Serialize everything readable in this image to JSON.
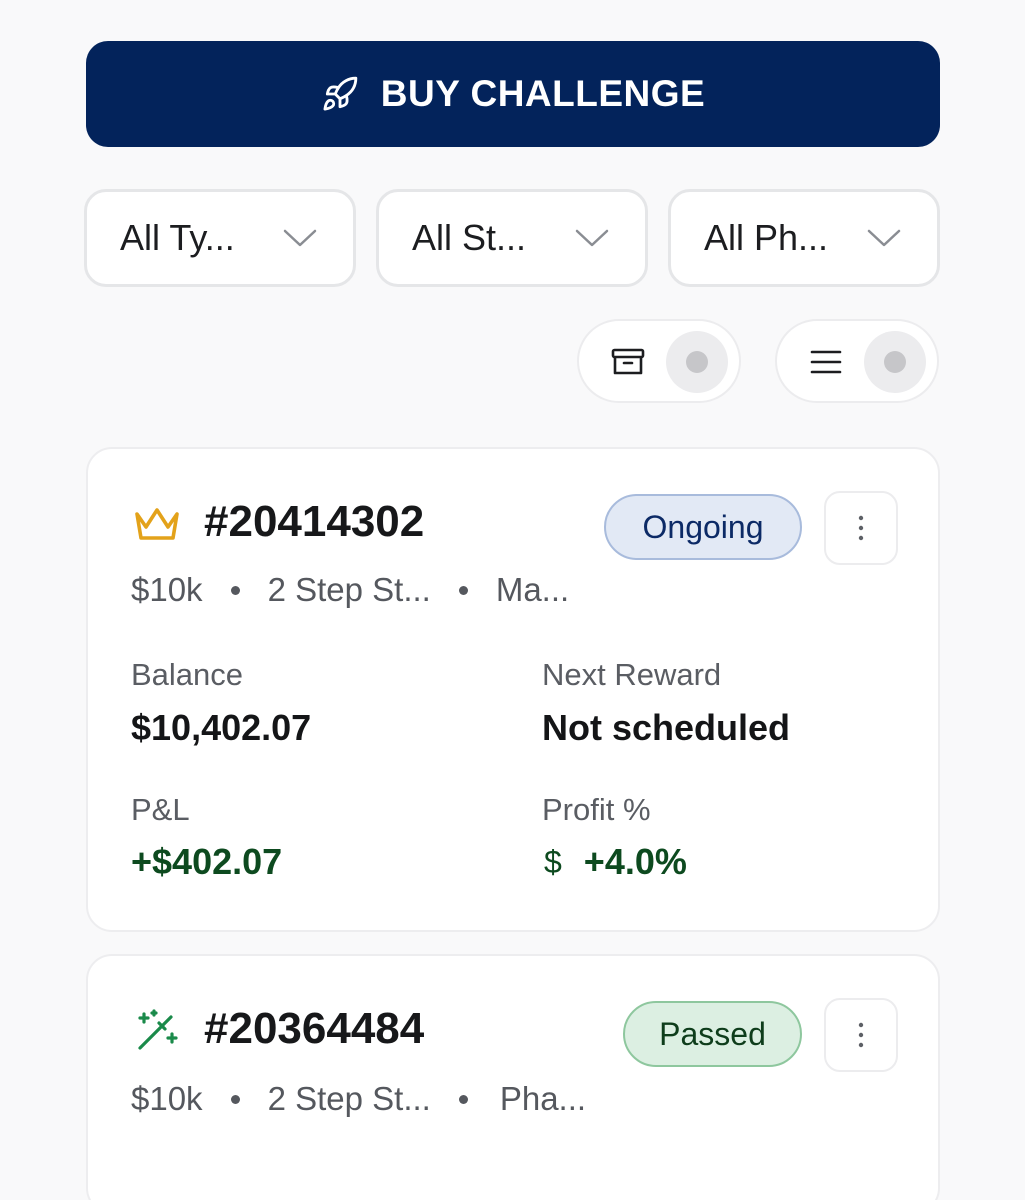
{
  "buy_button": {
    "label": "BUY CHALLENGE",
    "icon": "rocket-icon",
    "bg": "#03235b"
  },
  "filters": [
    {
      "text": "All Ty...",
      "icon": "chevron-down-icon"
    },
    {
      "text": "All St...",
      "icon": "chevron-down-icon"
    },
    {
      "text": "All Ph...",
      "icon": "chevron-down-icon"
    }
  ],
  "toggles": [
    {
      "icon": "archive-icon",
      "state": "off"
    },
    {
      "icon": "list-icon",
      "state": "off"
    }
  ],
  "accounts": [
    {
      "icon": "crown-icon",
      "icon_color": "#e3a21a",
      "id": "#20414302",
      "status": "Ongoing",
      "meta": [
        "$10k",
        "2 Step St...",
        "Ma..."
      ],
      "balance_label": "Balance",
      "balance": "$10,402.07",
      "next_reward_label": "Next Reward",
      "next_reward": "Not scheduled",
      "pnl_label": "P&L",
      "pnl": "+$402.07",
      "profit_label": "Profit %",
      "profit_icon": "$",
      "profit": "+4.0%"
    },
    {
      "icon": "magic-wand-icon",
      "icon_color": "#1a8a4a",
      "id": "#20364484",
      "status": "Passed",
      "meta": [
        "$10k",
        "2 Step St...",
        "Pha..."
      ]
    }
  ]
}
